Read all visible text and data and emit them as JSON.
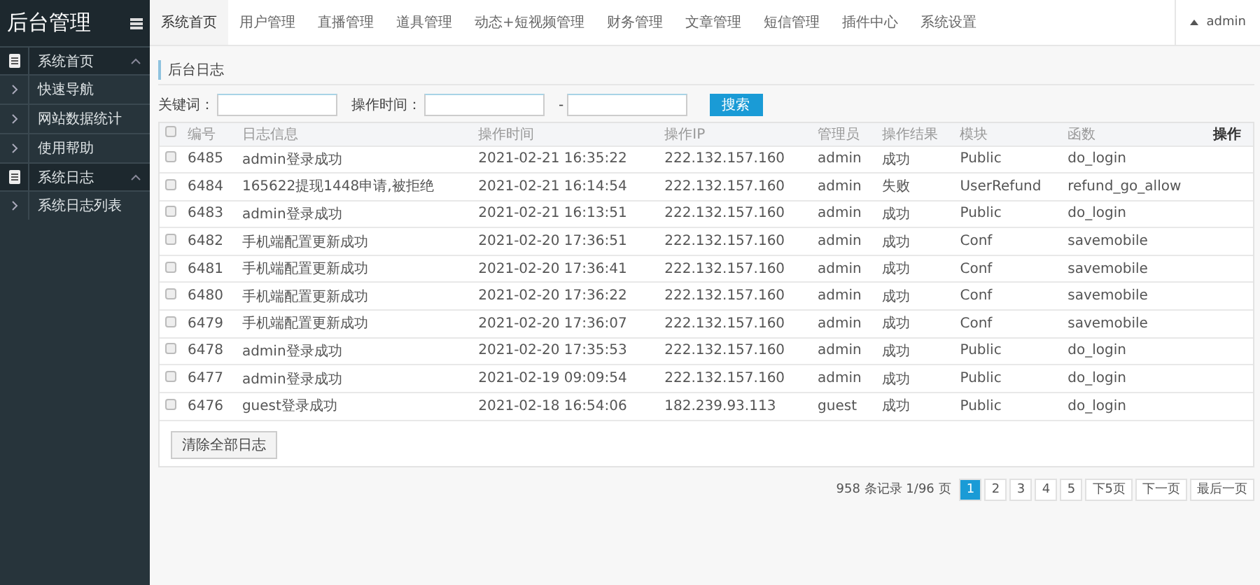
{
  "sidebar": {
    "title": "后台管理",
    "sections": [
      {
        "label": "系统首页",
        "expanded": true,
        "children": [
          {
            "label": "快速导航"
          },
          {
            "label": "网站数据统计"
          },
          {
            "label": "使用帮助"
          }
        ]
      },
      {
        "label": "系统日志",
        "expanded": true,
        "children": [
          {
            "label": "系统日志列表"
          }
        ]
      }
    ]
  },
  "nav": {
    "tabs": [
      {
        "label": "系统首页",
        "selected": true
      },
      {
        "label": "用户管理",
        "selected": false
      },
      {
        "label": "直播管理",
        "selected": false
      },
      {
        "label": "道具管理",
        "selected": false
      },
      {
        "label": "动态+短视频管理",
        "selected": false
      },
      {
        "label": "财务管理",
        "selected": false
      },
      {
        "label": "文章管理",
        "selected": false
      },
      {
        "label": "短信管理",
        "selected": false
      },
      {
        "label": "插件中心",
        "selected": false
      },
      {
        "label": "系统设置",
        "selected": false
      }
    ],
    "user": "admin"
  },
  "page_title": "后台日志",
  "filter": {
    "keyword_label": "关键词：",
    "time_label": "操作时间：",
    "separator": "-",
    "search_button": "搜索"
  },
  "table": {
    "select_all_checked": false,
    "columns": [
      "编号",
      "日志信息",
      "操作时间",
      "操作IP",
      "管理员",
      "操作结果",
      "模块",
      "函数",
      "操作"
    ],
    "rows": [
      {
        "checked": false,
        "cells": [
          "6485",
          "admin登录成功",
          "2021-02-21 16:35:22",
          "222.132.157.160",
          "admin",
          "成功",
          "Public",
          "do_login"
        ]
      },
      {
        "checked": false,
        "cells": [
          "6484",
          "165622提现1448申请,被拒绝",
          "2021-02-21 16:14:54",
          "222.132.157.160",
          "admin",
          "失败",
          "UserRefund",
          "refund_go_allow"
        ]
      },
      {
        "checked": false,
        "cells": [
          "6483",
          "admin登录成功",
          "2021-02-21 16:13:51",
          "222.132.157.160",
          "admin",
          "成功",
          "Public",
          "do_login"
        ]
      },
      {
        "checked": false,
        "cells": [
          "6482",
          "手机端配置更新成功",
          "2021-02-20 17:36:51",
          "222.132.157.160",
          "admin",
          "成功",
          "Conf",
          "savemobile"
        ]
      },
      {
        "checked": false,
        "cells": [
          "6481",
          "手机端配置更新成功",
          "2021-02-20 17:36:41",
          "222.132.157.160",
          "admin",
          "成功",
          "Conf",
          "savemobile"
        ]
      },
      {
        "checked": false,
        "cells": [
          "6480",
          "手机端配置更新成功",
          "2021-02-20 17:36:22",
          "222.132.157.160",
          "admin",
          "成功",
          "Conf",
          "savemobile"
        ]
      },
      {
        "checked": false,
        "cells": [
          "6479",
          "手机端配置更新成功",
          "2021-02-20 17:36:07",
          "222.132.157.160",
          "admin",
          "成功",
          "Conf",
          "savemobile"
        ]
      },
      {
        "checked": false,
        "cells": [
          "6478",
          "admin登录成功",
          "2021-02-20 17:35:53",
          "222.132.157.160",
          "admin",
          "成功",
          "Public",
          "do_login"
        ]
      },
      {
        "checked": false,
        "cells": [
          "6477",
          "admin登录成功",
          "2021-02-19 09:09:54",
          "222.132.157.160",
          "admin",
          "成功",
          "Public",
          "do_login"
        ]
      },
      {
        "checked": false,
        "cells": [
          "6476",
          "guest登录成功",
          "2021-02-18 16:54:06",
          "182.239.93.113",
          "guest",
          "成功",
          "Public",
          "do_login"
        ]
      }
    ],
    "clear_button": "清除全部日志"
  },
  "pagination": {
    "summary": "958 条记录 1/96 页",
    "pages": [
      {
        "label": "1",
        "selected": true
      },
      {
        "label": "2",
        "selected": false
      },
      {
        "label": "3",
        "selected": false
      },
      {
        "label": "4",
        "selected": false
      },
      {
        "label": "5",
        "selected": false
      }
    ],
    "buttons": [
      "下5页",
      "下一页",
      "最后一页"
    ]
  }
}
